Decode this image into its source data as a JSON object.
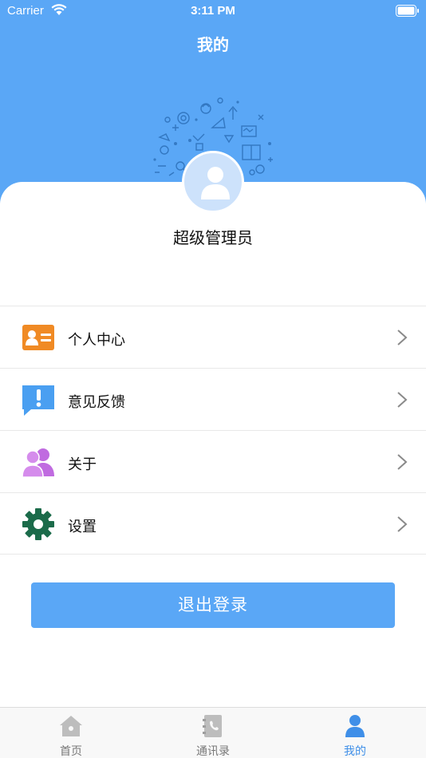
{
  "status_bar": {
    "carrier": "Carrier",
    "time": "3:11 PM"
  },
  "nav": {
    "title": "我的"
  },
  "profile": {
    "username": "超级管理员"
  },
  "menu": [
    {
      "label": "个人中心",
      "icon": "id-card-icon",
      "color": "#f08a24"
    },
    {
      "label": "意见反馈",
      "icon": "feedback-icon",
      "color": "#4a9ff1"
    },
    {
      "label": "关于",
      "icon": "people-icon",
      "color": "#c06be0"
    },
    {
      "label": "设置",
      "icon": "gear-icon",
      "color": "#1b6b4a"
    }
  ],
  "logout": {
    "label": "退出登录"
  },
  "tabs": [
    {
      "label": "首页",
      "icon": "home-icon"
    },
    {
      "label": "通讯录",
      "icon": "contacts-icon"
    },
    {
      "label": "我的",
      "icon": "user-icon",
      "active": true
    }
  ],
  "colors": {
    "primary": "#5aa7f6",
    "active_tab": "#3f8fe8"
  }
}
